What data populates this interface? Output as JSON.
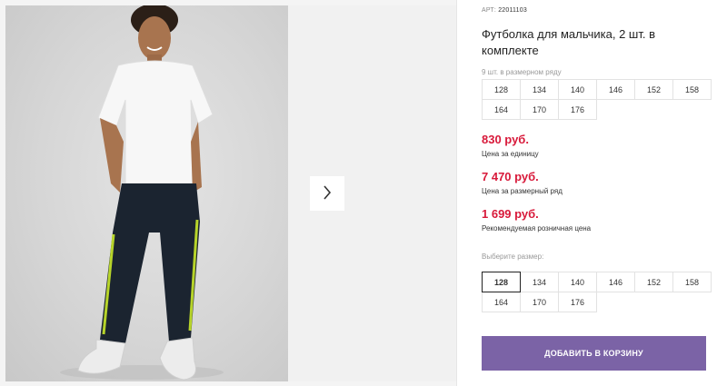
{
  "product": {
    "article_label": "АРТ:",
    "article_code": "22011103",
    "title": "Футболка для мальчика, 2 шт. в комплекте",
    "row_note": "9 шт. в размерном ряду",
    "sizes_in_row": [
      "128",
      "134",
      "140",
      "146",
      "152",
      "158",
      "164",
      "170",
      "176"
    ]
  },
  "prices": [
    {
      "value": "830 руб.",
      "label": "Цена за единицу"
    },
    {
      "value": "7 470 руб.",
      "label": "Цена за размерный ряд"
    },
    {
      "value": "1 699 руб.",
      "label": "Рекомендуемая розничная цена"
    }
  ],
  "size_selector": {
    "label": "Выберите размер:",
    "options": [
      "128",
      "134",
      "140",
      "146",
      "152",
      "158",
      "164",
      "170",
      "176"
    ],
    "selected": "128"
  },
  "cart": {
    "add_label": "ДОБАВИТЬ В КОРЗИНУ"
  },
  "icons": {
    "next": "chevron-right-icon"
  },
  "colors": {
    "accent": "#7b63a6",
    "price": "#d8193a"
  }
}
